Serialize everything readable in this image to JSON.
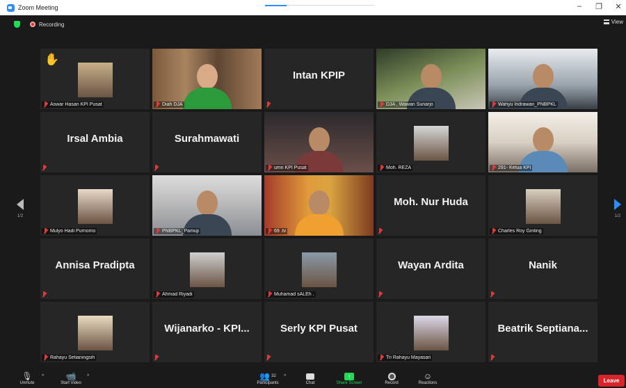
{
  "window": {
    "title": "Zoom Meeting",
    "controls": [
      "–",
      "❐",
      "✕"
    ]
  },
  "topbar": {
    "recording_label": "Recording",
    "view_label": "View"
  },
  "nav": {
    "left_page": "1/2",
    "right_page": "1/2"
  },
  "tiles": [
    {
      "name": "Aswar Hasan KPI Pusat",
      "style": "avatar",
      "hand": true
    },
    {
      "name": "Diah DJA",
      "style": "video"
    },
    {
      "name": "Intan KPIP",
      "style": "text"
    },
    {
      "name": "DJA , Wawan Sunarjo",
      "style": "video"
    },
    {
      "name": "Wahyu Indrawan_PNBPKL",
      "style": "video"
    },
    {
      "name": "Irsal Ambia",
      "style": "text"
    },
    {
      "name": "Surahmawati",
      "style": "text"
    },
    {
      "name": "umri KPI Pusat",
      "style": "video"
    },
    {
      "name": "Moh. REZA",
      "style": "avatar"
    },
    {
      "name": "291- Ketua KPI",
      "style": "video",
      "active": true
    },
    {
      "name": "Mulyo Hadi Purnomo",
      "style": "avatar"
    },
    {
      "name": "PNBPKL_Pamuji",
      "style": "video"
    },
    {
      "name": "69 .tv",
      "style": "video"
    },
    {
      "name": "Moh. Nur Huda",
      "style": "text"
    },
    {
      "name": "Charles Roy Ginting",
      "style": "avatar"
    },
    {
      "name": "Annisa Pradipta",
      "style": "text"
    },
    {
      "name": "Ahmad Riyadi",
      "style": "avatar"
    },
    {
      "name": "Muhamad sALEh .",
      "style": "avatar"
    },
    {
      "name": "Wayan Ardita",
      "style": "text"
    },
    {
      "name": "Nanik",
      "style": "text"
    },
    {
      "name": "Rahayu Setianingsih",
      "style": "avatar"
    },
    {
      "name": "Wijanarko - KPI...",
      "style": "text"
    },
    {
      "name": "Serly KPI Pusat",
      "style": "text"
    },
    {
      "name": "Tri Rahayu Mayasari",
      "style": "avatar"
    },
    {
      "name": "Beatrik Septiana...",
      "style": "text"
    }
  ],
  "toolbar": {
    "unmute": "Unmute",
    "start_video": "Start Video",
    "participants": "Participants",
    "participants_count": "32",
    "chat": "Chat",
    "share_screen": "Share Screen",
    "record": "Record",
    "reactions": "Reactions",
    "leave": "Leave"
  },
  "colors": {
    "active_speaker": "#c9df4a",
    "accent": "#2d8cff",
    "leave": "#d8242a",
    "share_green": "#23d959"
  }
}
